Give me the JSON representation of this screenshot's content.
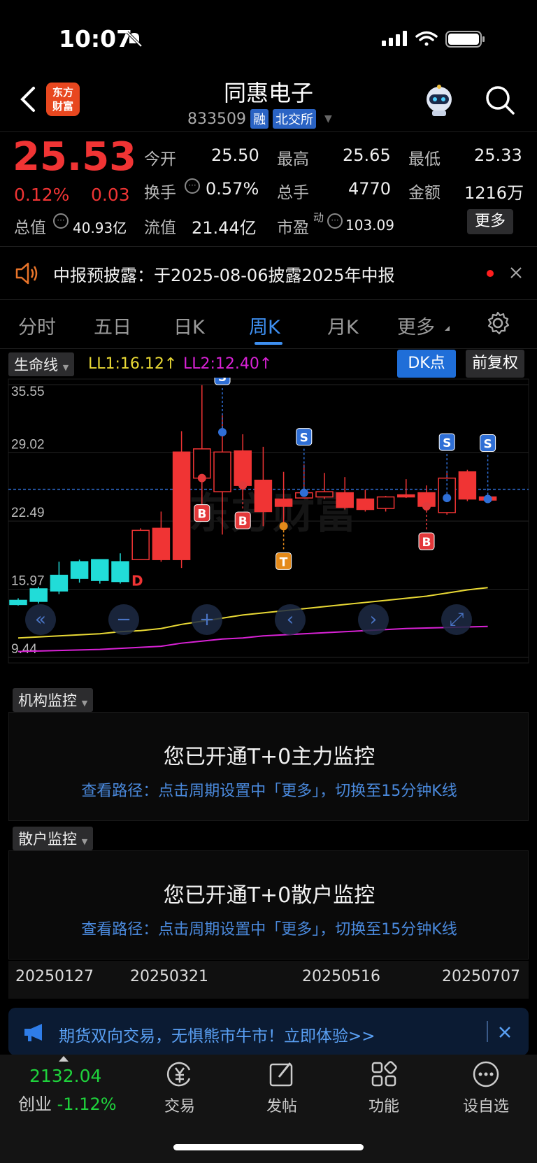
{
  "status_bar": {
    "time": "10:07"
  },
  "header": {
    "logo_line1": "东方",
    "logo_line2": "财富",
    "title": "同惠电子",
    "code": "833509",
    "tag_margin": "融",
    "tag_exchange": "北交所"
  },
  "quote": {
    "price": "25.53",
    "change_pct": "0.12%",
    "change_amt": "0.03",
    "open_label": "今开",
    "open": "25.50",
    "high_label": "最高",
    "high": "25.65",
    "low_label": "最低",
    "low": "25.33",
    "turnover_label": "换手",
    "turnover": "0.57%",
    "volume_label": "总手",
    "volume": "4770",
    "amount_label": "金额",
    "amount": "1216万",
    "mktcap_label": "总值",
    "mktcap": "40.93亿",
    "float_label": "流值",
    "float": "21.44亿",
    "pe_label": "市盈",
    "pe_super": "动",
    "pe": "103.09",
    "more_label": "更多"
  },
  "notice": {
    "text": "中报预披露：于2025-08-06披露2025年中报"
  },
  "tabs": [
    "分时",
    "五日",
    "日K",
    "周K",
    "月K",
    "更多"
  ],
  "active_tab": "周K",
  "chart_controls": {
    "indicator": "生命线",
    "ll1": "LL1:16.12↑",
    "ll2": "LL2:12.40↑",
    "dk_label": "DK点",
    "adjust_label": "前复权"
  },
  "chart_data": {
    "type": "candlestick",
    "y_ticks": [
      "35.55",
      "29.02",
      "22.49",
      "15.97",
      "9.44"
    ],
    "ylim": [
      9.44,
      35.55
    ],
    "last_price": 25.53,
    "candles": [
      {
        "o": 14.5,
        "c": 14.9,
        "h": 15.1,
        "l": 14.4,
        "up": true
      },
      {
        "o": 14.8,
        "c": 16.0,
        "h": 16.2,
        "l": 14.6,
        "up": true
      },
      {
        "o": 15.8,
        "c": 17.3,
        "h": 18.6,
        "l": 15.5,
        "up": true
      },
      {
        "o": 17.0,
        "c": 18.6,
        "h": 18.8,
        "l": 16.6,
        "up": true
      },
      {
        "o": 16.8,
        "c": 18.8,
        "h": 18.8,
        "l": 16.5,
        "up": true
      },
      {
        "o": 16.7,
        "c": 18.6,
        "h": 19.4,
        "l": 16.5,
        "up": true
      },
      {
        "o": 18.8,
        "c": 21.6,
        "h": 21.8,
        "l": 18.8,
        "up": false
      },
      {
        "o": 18.8,
        "c": 21.8,
        "h": 23.4,
        "l": 18.6,
        "up": false
      },
      {
        "o": 18.8,
        "c": 29.1,
        "h": 31.1,
        "l": 18.0,
        "up": false
      },
      {
        "o": 26.6,
        "c": 29.4,
        "h": 35.5,
        "l": 23.6,
        "up": false
      },
      {
        "o": 25.3,
        "c": 29.1,
        "h": 32.6,
        "l": 21.2,
        "up": false
      },
      {
        "o": 25.9,
        "c": 29.2,
        "h": 30.8,
        "l": 24.6,
        "up": false
      },
      {
        "o": 23.4,
        "c": 26.4,
        "h": 29.6,
        "l": 22.0,
        "up": false
      },
      {
        "o": 23.9,
        "c": 24.6,
        "h": 27.2,
        "l": 22.1,
        "up": false
      },
      {
        "o": 24.7,
        "c": 25.2,
        "h": 27.9,
        "l": 24.7,
        "up": false
      },
      {
        "o": 24.8,
        "c": 25.3,
        "h": 27.1,
        "l": 24.6,
        "up": false
      },
      {
        "o": 23.8,
        "c": 25.2,
        "h": 26.7,
        "l": 23.6,
        "up": false
      },
      {
        "o": 23.6,
        "c": 24.6,
        "h": 25.5,
        "l": 23.4,
        "up": false
      },
      {
        "o": 23.7,
        "c": 24.8,
        "h": 24.9,
        "l": 23.4,
        "up": false
      },
      {
        "o": 24.8,
        "c": 25.0,
        "h": 26.5,
        "l": 24.7,
        "up": false
      },
      {
        "o": 23.9,
        "c": 25.2,
        "h": 25.9,
        "l": 23.5,
        "up": false
      },
      {
        "o": 23.3,
        "c": 26.6,
        "h": 27.1,
        "l": 23.1,
        "up": false
      },
      {
        "o": 24.6,
        "c": 27.2,
        "h": 27.4,
        "l": 24.4,
        "up": false
      },
      {
        "o": 24.5,
        "c": 24.8,
        "h": 24.9,
        "l": 24.4,
        "up": false
      }
    ],
    "ll1": [
      11.3,
      11.4,
      11.5,
      11.6,
      11.7,
      11.9,
      12.0,
      12.2,
      12.6,
      12.9,
      13.2,
      13.5,
      13.7,
      13.9,
      14.1,
      14.3,
      14.5,
      14.7,
      14.9,
      15.1,
      15.3,
      15.6,
      15.9,
      16.12
    ],
    "ll2": [
      10.0,
      10.05,
      10.1,
      10.15,
      10.2,
      10.3,
      10.4,
      10.5,
      10.8,
      11.0,
      11.2,
      11.3,
      11.5,
      11.6,
      11.7,
      11.8,
      11.9,
      12.0,
      12.1,
      12.2,
      12.25,
      12.3,
      12.35,
      12.4
    ],
    "signals": [
      {
        "i": 9,
        "label": "B",
        "kind": "B",
        "price": 26.6,
        "below": true
      },
      {
        "i": 10,
        "label": "S",
        "kind": "S",
        "price": 31.0,
        "below": false,
        "markerBelow": true
      },
      {
        "i": 11,
        "label": "B",
        "kind": "B",
        "price": 25.9,
        "below": true
      },
      {
        "i": 13,
        "label": "T",
        "kind": "T",
        "price": 22.0,
        "below": true
      },
      {
        "i": 14,
        "label": "S",
        "kind": "S",
        "price": 25.2,
        "below": false
      },
      {
        "i": 20,
        "label": "B",
        "kind": "B",
        "price": 23.9,
        "below": true
      },
      {
        "i": 21,
        "label": "S",
        "kind": "S",
        "price": 24.7,
        "below": false
      },
      {
        "i": 23,
        "label": "S",
        "kind": "S",
        "price": 24.6,
        "below": false
      }
    ],
    "d_marker": "D",
    "x_ticks": [
      "20250127",
      "20250321",
      "20250516",
      "20250707"
    ]
  },
  "monitor_inst": {
    "chip": "机构监控",
    "title": "您已开通T+0主力监控",
    "sub": "查看路径：点击周期设置中「更多」，切换至15分钟K线"
  },
  "monitor_retail": {
    "chip": "散户监控",
    "title": "您已开通T+0散户监控",
    "sub": "查看路径：点击周期设置中「更多」，切换至15分钟K线"
  },
  "banner": {
    "text": "期货双向交易，无惧熊市牛市！立即体验>>"
  },
  "bottom_nav": {
    "index_value": "2132.04",
    "index_name": "创业",
    "index_change": "-1.12%",
    "items": [
      "交易",
      "发帖",
      "功能",
      "设自选"
    ]
  },
  "colors": {
    "up": "#f03434",
    "down": "#1fd33c",
    "cyan": "#21dcd8",
    "accent": "#3e8ff0",
    "ll1": "#e9d935",
    "ll2": "#d922d6"
  }
}
